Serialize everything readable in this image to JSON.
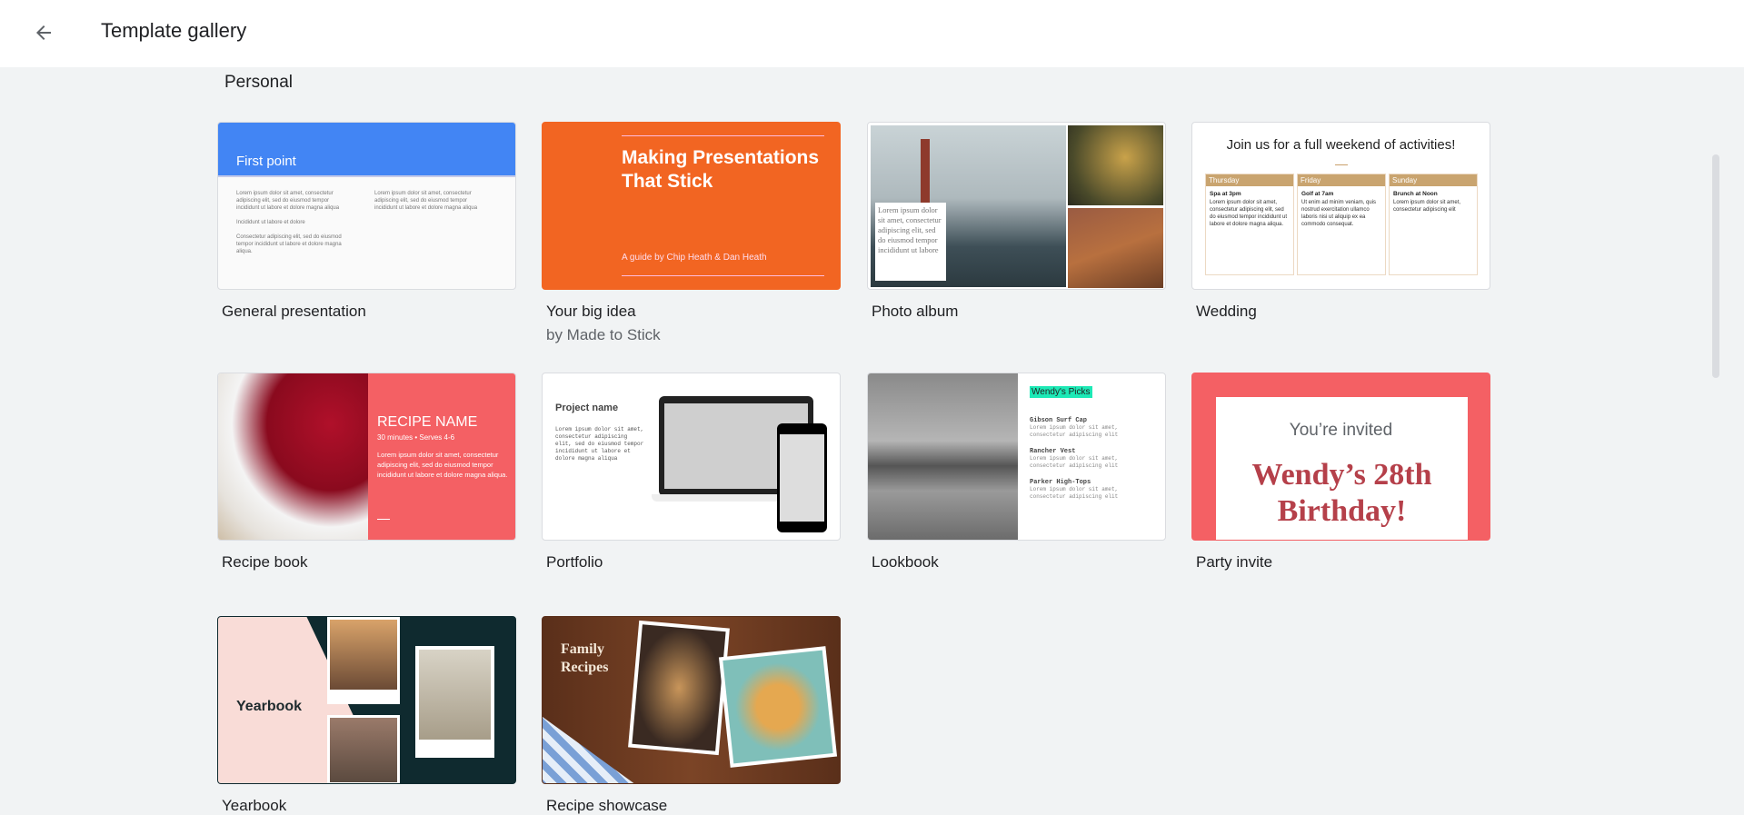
{
  "header": {
    "title": "Template gallery",
    "back_icon": "arrow-left-icon"
  },
  "section": "Personal",
  "templates": [
    {
      "label": "General presentation",
      "thumb": {
        "heading": "First point",
        "col1": "Lorem ipsum dolor sit amet, consectetur adipiscing elit, sed do eiusmod tempor incididunt ut labore et dolore magna aliqua",
        "line2": "Incididunt ut labore et dolore",
        "line3": "Consectetur adipiscing elit, sed do eiusmod tempor incididunt ut labore et dolore magna aliqua.",
        "col2": "Lorem ipsum dolor sit amet, consectetur adipiscing elit, sed do eiusmod tempor incididunt ut labore et dolore magna aliqua"
      }
    },
    {
      "label": "Your big idea",
      "sublabel": "by Made to Stick",
      "thumb": {
        "heading": "Making Presentations That Stick",
        "byline": "A guide by Chip Heath & Dan Heath"
      }
    },
    {
      "label": "Photo album",
      "thumb": {
        "caption": "Lorem ipsum dolor sit amet, consectetur adipiscing elit, sed do eiusmod tempor incididunt ut labore"
      }
    },
    {
      "label": "Wedding",
      "thumb": {
        "heading": "Join us for a full weekend of activities!",
        "days": [
          {
            "day": "Thursday",
            "event": "Spa at 3pm",
            "text": "Lorem ipsum dolor sit amet, consectetur adipiscing elit, sed do eiusmod tempor incididunt ut labore et dolore magna aliqua."
          },
          {
            "day": "Friday",
            "event": "Golf at 7am",
            "text": "Ut enim ad minim veniam, quis nostrud exercitation ullamco laboris nisi ut aliquip ex ea commodo consequat."
          },
          {
            "day": "Sunday",
            "event": "Brunch at Noon",
            "text": "Lorem ipsum dolor sit amet, consectetur adipiscing elit"
          }
        ]
      }
    },
    {
      "label": "Recipe book",
      "thumb": {
        "heading": "RECIPE NAME",
        "meta": "30 minutes • Serves 4-6",
        "text": "Lorem ipsum dolor sit amet, consectetur adipiscing elit, sed do eiusmod tempor incididunt ut labore et dolore magna aliqua."
      }
    },
    {
      "label": "Portfolio",
      "thumb": {
        "heading": "Project name",
        "text": "Lorem ipsum dolor sit amet, consectetur adipiscing elit, sed do eiusmod tempor incididunt ut labore et dolore magna aliqua"
      }
    },
    {
      "label": "Lookbook",
      "thumb": {
        "heading": "Wendy's Picks",
        "items": [
          {
            "name": "Gibson Surf Cap",
            "text": "Lorem ipsum dolor sit amet, consectetur adipiscing elit"
          },
          {
            "name": "Rancher Vest",
            "text": "Lorem ipsum dolor sit amet, consectetur adipiscing elit"
          },
          {
            "name": "Parker High-Tops",
            "text": "Lorem ipsum dolor sit amet, consectetur adipiscing elit"
          }
        ]
      }
    },
    {
      "label": "Party invite",
      "thumb": {
        "line1": "You’re invited",
        "line2": "Wendy’s 28th Birthday!"
      }
    },
    {
      "label": "Yearbook",
      "thumb": {
        "heading": "Yearbook"
      }
    },
    {
      "label": "Recipe showcase",
      "thumb": {
        "heading": "Family Recipes"
      }
    }
  ]
}
